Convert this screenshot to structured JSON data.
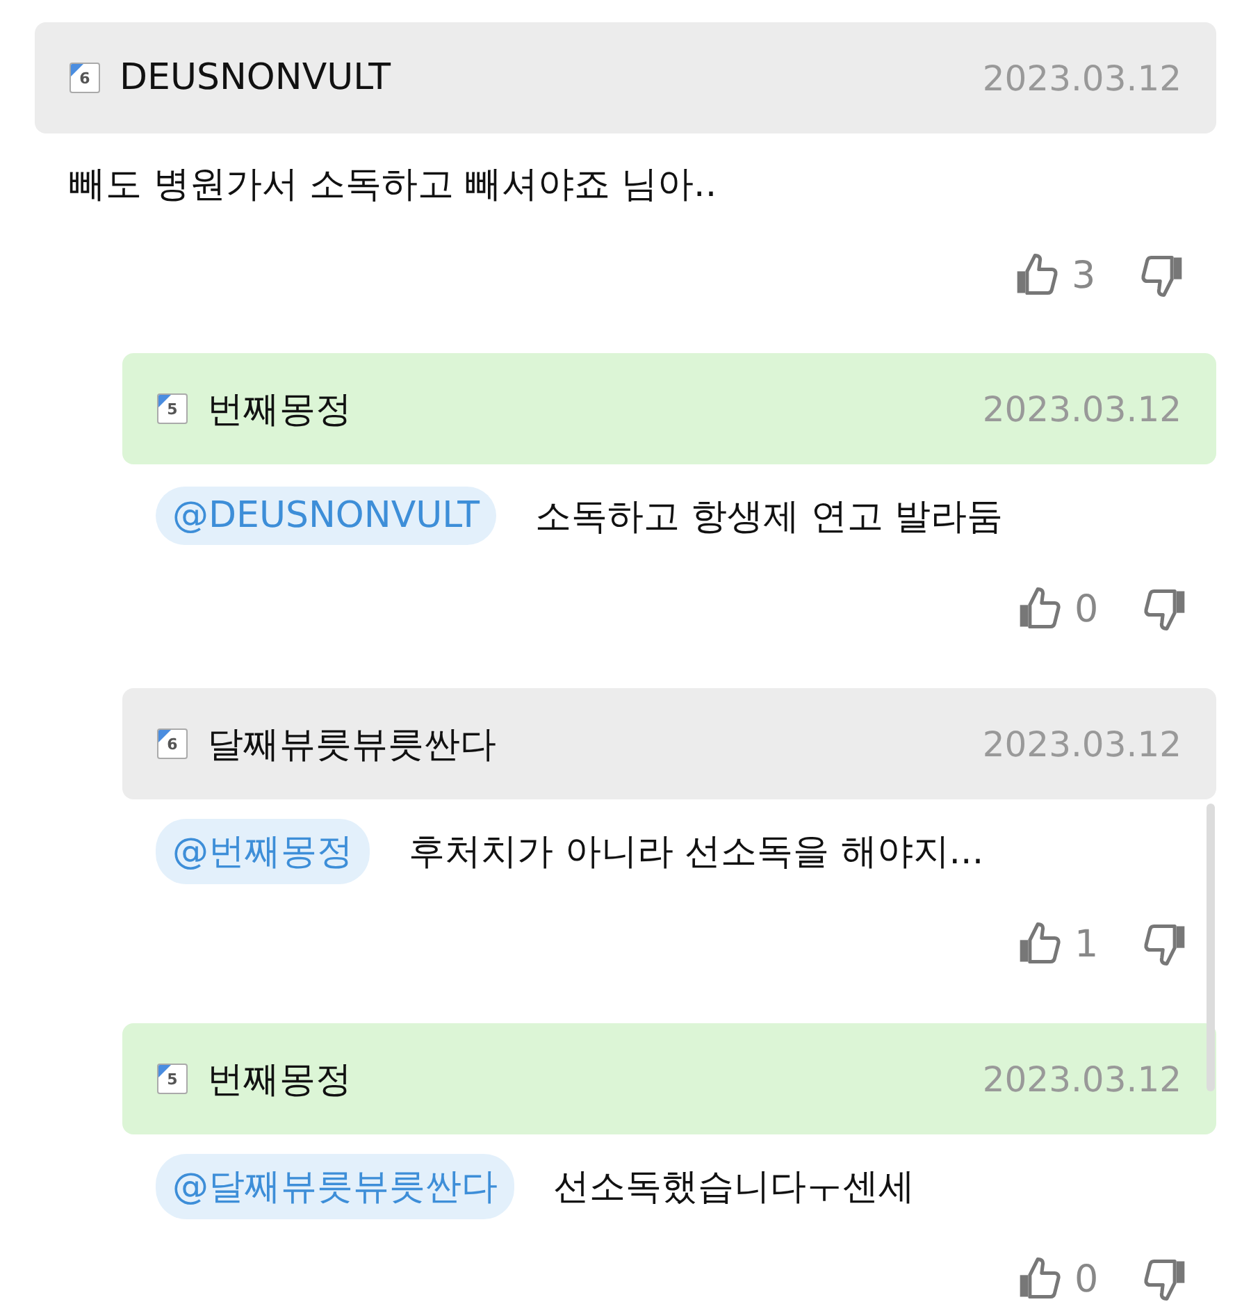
{
  "comments": [
    {
      "author": "DEUSNONVULT",
      "level": "6",
      "highlighted": false,
      "date": "2023.03.12",
      "text": "빼도 병원가서 소독하고 빼셔야죠 님아..",
      "likes": "3",
      "children": [
        {
          "author": "번째몽정",
          "level": "5",
          "highlighted": true,
          "date": "2023.03.12",
          "mention": "@DEUSNONVULT",
          "text": "소독하고 항생제 연고 발라둠",
          "likes": "0"
        },
        {
          "author": "달째뷰릇뷰릇싼다",
          "level": "6",
          "highlighted": false,
          "date": "2023.03.12",
          "mention": "@번째몽정",
          "text": "후처치가 아니라 선소독을 해야지...",
          "likes": "1"
        },
        {
          "author": "번째몽정",
          "level": "5",
          "highlighted": true,
          "date": "2023.03.12",
          "mention": "@달째뷰릇뷰릇싼다",
          "text": "선소독했습니다ㅜ센세",
          "likes": "0"
        }
      ]
    }
  ]
}
